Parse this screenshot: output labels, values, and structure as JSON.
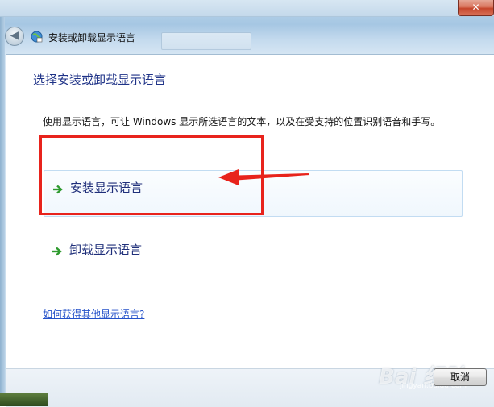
{
  "window": {
    "header_title": "安装或卸载显示语言",
    "close_label": "✕",
    "back_label": "◀"
  },
  "content": {
    "page_title": "选择安装或卸载显示语言",
    "description": "使用显示语言，可让 Windows 显示所选语言的文本，以及在受支持的位置识别语音和手写。",
    "options": [
      {
        "label": "安装显示语言",
        "icon": "green-arrow-icon"
      },
      {
        "label": "卸载显示语言",
        "icon": "green-arrow-icon"
      }
    ],
    "help_link": "如何获得其他显示语言?"
  },
  "footer": {
    "cancel_label": "取消"
  },
  "watermark": {
    "text": "Bai 经验",
    "sub": "jingyan.baidu.com"
  },
  "colors": {
    "title_blue": "#1e3287",
    "link_blue": "#2451c9",
    "annotation_red": "#e8231c",
    "arrow_green": "#2e9a2e"
  }
}
